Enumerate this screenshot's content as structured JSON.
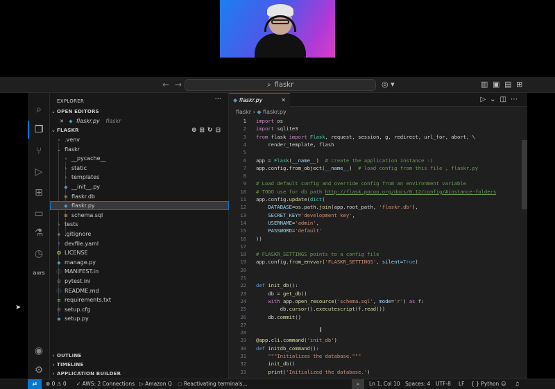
{
  "titlebar": {
    "back": "←",
    "forward": "→",
    "search_text": "flaskr"
  },
  "explorer": {
    "title": "EXPLORER",
    "more": "···",
    "open_editors_label": "OPEN EDITORS",
    "open_editor_file": "flaskr.py",
    "open_editor_path": "flaskr",
    "root_label": "FLASKR",
    "tree": [
      {
        "label": ".venv",
        "depth": 1,
        "kind": "folder-closed"
      },
      {
        "label": "flaskr",
        "depth": 1,
        "kind": "folder-open"
      },
      {
        "label": "__pycache__",
        "depth": 2,
        "kind": "folder-closed"
      },
      {
        "label": "static",
        "depth": 2,
        "kind": "folder-closed"
      },
      {
        "label": "templates",
        "depth": 2,
        "kind": "folder-closed"
      },
      {
        "label": "__init__.py",
        "depth": 2,
        "kind": "python"
      },
      {
        "label": "flaskr.db",
        "depth": 2,
        "kind": "db"
      },
      {
        "label": "flaskr.py",
        "depth": 2,
        "kind": "python",
        "selected": true
      },
      {
        "label": "schema.sql",
        "depth": 2,
        "kind": "db"
      },
      {
        "label": "tests",
        "depth": 1,
        "kind": "folder-closed"
      },
      {
        "label": ".gitignore",
        "depth": 1,
        "kind": "git"
      },
      {
        "label": "devfile.yaml",
        "depth": 1,
        "kind": "yaml"
      },
      {
        "label": "LICENSE",
        "depth": 1,
        "kind": "license"
      },
      {
        "label": "manage.py",
        "depth": 1,
        "kind": "python"
      },
      {
        "label": "MANIFEST.in",
        "depth": 1,
        "kind": "info"
      },
      {
        "label": "pytest.ini",
        "depth": 1,
        "kind": "settings"
      },
      {
        "label": "README.md",
        "depth": 1,
        "kind": "info"
      },
      {
        "label": "requirements.txt",
        "depth": 1,
        "kind": "text"
      },
      {
        "label": "setup.cfg",
        "depth": 1,
        "kind": "settings"
      },
      {
        "label": "setup.py",
        "depth": 1,
        "kind": "python"
      }
    ],
    "outline_label": "OUTLINE",
    "timeline_label": "TIMELINE",
    "app_builder_label": "APPLICATION BUILDER"
  },
  "editor": {
    "tab_label": "flaskr.py",
    "breadcrumb_folder": "flaskr",
    "breadcrumb_sep": "›",
    "breadcrumb_file": "flaskr.py",
    "lines": [
      "<span class=\"k\">import</span> os",
      "<span class=\"k\">import</span> sqlite3",
      "<span class=\"k\">from</span> flask <span class=\"k\">import</span> <span class=\"b\">Flask</span>, request, session, g, redirect, url_for, abort, \\",
      "    render_template, flash",
      "",
      "app = <span class=\"b\">Flask</span>(<span class=\"v\">__name__</span>)  <span class=\"c\"># create the application instance :)</span>",
      "app.config.<span class=\"f\">from_object</span>(<span class=\"v\">__name__</span>)  <span class=\"c\"># load config from this file , flaskr.py</span>",
      "",
      "<span class=\"c\"># Load default config and override config from an environment variable</span>",
      "<span class=\"c\"># TODO use for db path </span><span class=\"u\">http://flask.pocoo.org/docs/0.12/config/#instance-folders</span>",
      "app.config.<span class=\"f\">update</span>(<span class=\"b\">dict</span>(",
      "    <span class=\"v\">DATABASE</span>=os.path.<span class=\"f\">join</span>(app.root_path, <span class=\"s\">'flaskr.db'</span>),",
      "    <span class=\"v\">SECRET_KEY</span>=<span class=\"s\">'development key'</span>,",
      "    <span class=\"v\">USERNAME</span>=<span class=\"s\">'admin'</span>,",
      "    <span class=\"v\">PASSWORD</span>=<span class=\"s\">'default'</span>",
      "))",
      "",
      "<span class=\"c\"># FLASKR_SETTINGS points to a config file</span>",
      "app.config.<span class=\"f\">from_envvar</span>(<span class=\"s\">'FLASKR_SETTINGS'</span>, <span class=\"v\">silent</span>=<span class=\"n\">True</span>)",
      "",
      "",
      "<span class=\"kw\">def</span> <span class=\"f\">init_db</span>():",
      "    db = <span class=\"f\">get_db</span>()",
      "    <span class=\"k\">with</span> app.<span class=\"f\">open_resource</span>(<span class=\"s\">'schema.sql'</span>, <span class=\"v\">mode</span>=<span class=\"s\">'r'</span>) <span class=\"k\">as</span> f:",
      "        db.<span class=\"f\">cursor</span>().<span class=\"f\">executescript</span>(f.<span class=\"f\">read</span>())",
      "    db.<span class=\"f\">commit</span>()",
      "",
      "",
      "<span class=\"d\">@app.cli.command</span>(<span class=\"s\">'init_db'</span>)",
      "<span class=\"kw\">def</span> <span class=\"f\">initdb_command</span>():",
      "    <span class=\"s\">\"\"\"Initializes the database.\"\"\"</span>",
      "    <span class=\"f\">init_db</span>()",
      "    <span class=\"f\">print</span>(<span class=\"s\">'Initialized the database.'</span>)"
    ]
  },
  "statusbar": {
    "remote": "⇄",
    "problems": "⊗ 0 ⚠ 0",
    "aws": "✓ AWS: 2 Connections",
    "amazon_q": "▷ Amazon Q",
    "terminals": "◌ Reactivating terminals...",
    "position": "Ln 1, Col 10",
    "spaces": "Spaces: 4",
    "encoding": "UTF-8",
    "eol": "LF",
    "language": "{ } Python"
  },
  "colors": {
    "accent": "#0078d4",
    "background": "#1f1f1f",
    "sidebar": "#181818"
  }
}
